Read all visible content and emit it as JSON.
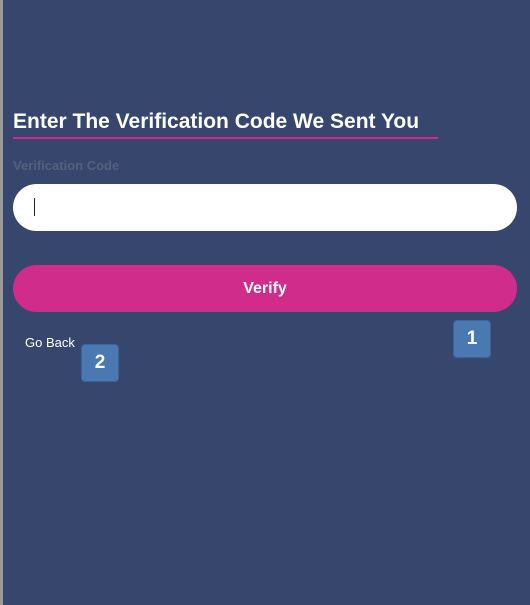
{
  "verification": {
    "title": "Enter The Verification Code We Sent You",
    "field_label": "Verification Code",
    "input_value": "",
    "input_placeholder": "",
    "verify_label": "Verify",
    "go_back_label": "Go Back"
  },
  "markers": [
    {
      "label": "1"
    },
    {
      "label": "2"
    }
  ],
  "colors": {
    "background": "#36466c",
    "accent": "#cf2c8c",
    "marker": "#4a78b0"
  }
}
